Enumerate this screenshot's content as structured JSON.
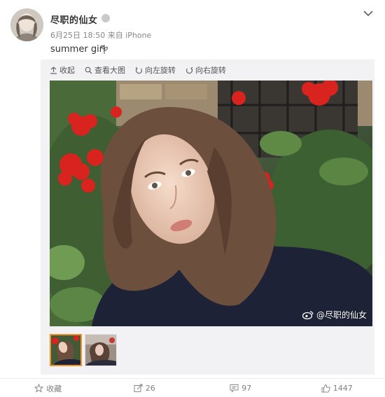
{
  "header": {
    "user_name": "尽职的仙女",
    "meta": "6月25日 18:50 来自 iPhone",
    "text": "summer girl"
  },
  "toolbar": {
    "collapse_label": "收起",
    "view_large_label": "查看大图",
    "rotate_left_label": "向左旋转",
    "rotate_right_label": "向右旋转"
  },
  "media": {
    "watermark": "@尽职的仙女",
    "thumbnails": [
      {
        "selected": true
      },
      {
        "selected": false
      }
    ]
  },
  "actions": {
    "favorite_label": "收藏",
    "repost_count": "26",
    "comment_count": "97",
    "like_count": "1447"
  },
  "icons": {
    "chevron": "chevron-down-icon",
    "emoji": "plant-emoji-icon",
    "collapse": "collapse-up-icon",
    "view_large": "magnifier-icon",
    "rotate_left": "rotate-left-icon",
    "rotate_right": "rotate-right-icon",
    "weibo": "weibo-logo-icon",
    "favorite": "star-icon",
    "repost": "repost-icon",
    "comment": "comment-icon",
    "like": "thumbs-up-icon"
  },
  "colors": {
    "selected_thumb_border": "#f28f27",
    "toolbar_bg": "#f2f2f5",
    "meta_text": "#888888"
  }
}
